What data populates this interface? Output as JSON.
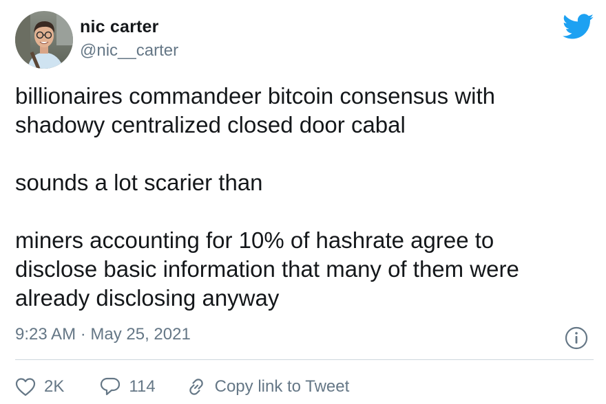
{
  "author": {
    "name": "nic carter",
    "handle": "@nic__carter"
  },
  "tweet": {
    "paragraphs": [
      {
        "lines": [
          "billionaires commandeer bitcoin consensus with",
          "shadowy centralized closed door cabal"
        ]
      },
      {
        "lines": [
          "sounds a lot scarier than"
        ]
      },
      {
        "lines": [
          "miners accounting for 10% of hashrate agree to",
          "disclose basic information that many of them were",
          "already disclosing anyway"
        ]
      }
    ],
    "timestamp": "9:23 AM · May 25, 2021"
  },
  "actions": {
    "likes": "2K",
    "replies": "114",
    "copy_link": "Copy link to Tweet"
  },
  "icons": {
    "brand": "twitter-bird-icon",
    "info": "info-icon",
    "like": "heart-icon",
    "reply": "speech-bubble-icon",
    "link": "link-icon"
  },
  "colors": {
    "brand": "#1da1f2",
    "text": "#14171a",
    "secondary": "#657786",
    "divider": "#ccd6dd"
  }
}
